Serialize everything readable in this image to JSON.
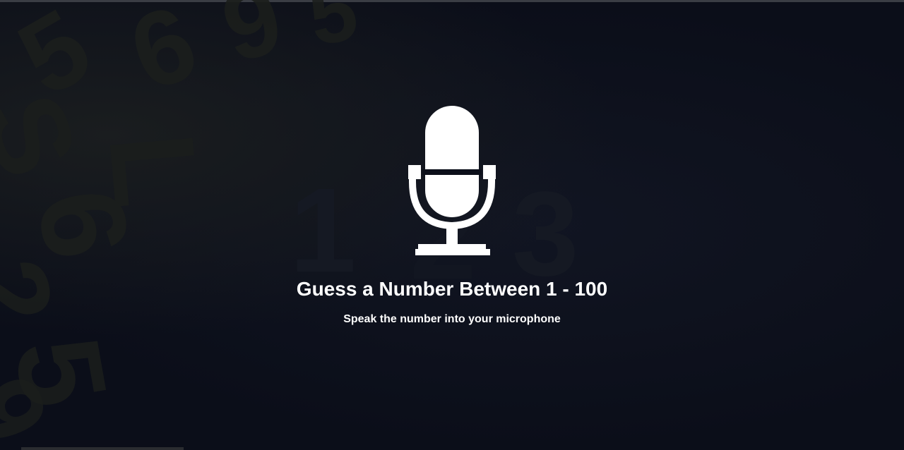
{
  "app": {
    "title": "Guess a Number Between 1 - 100",
    "subtitle": "Speak the number into your microphone"
  },
  "icons": {
    "microphone": "microphone-icon"
  },
  "colors": {
    "background": "#0c0f1a",
    "text": "#ffffff",
    "decor_numbers": "#1c1f1c"
  }
}
